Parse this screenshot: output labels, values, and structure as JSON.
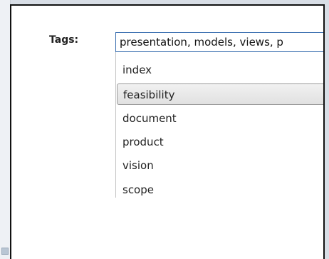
{
  "tags": {
    "label": "Tags:",
    "value": "presentation, models, views, p"
  },
  "suggestions": [
    {
      "label": "index",
      "selected": false
    },
    {
      "label": "feasibility",
      "selected": true
    },
    {
      "label": "document",
      "selected": false
    },
    {
      "label": "product",
      "selected": false
    },
    {
      "label": "vision",
      "selected": false
    },
    {
      "label": "scope",
      "selected": false
    }
  ]
}
